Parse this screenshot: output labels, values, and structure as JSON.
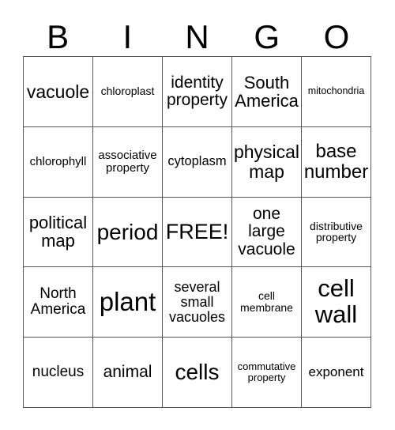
{
  "card": {
    "title": "BINGO",
    "header_letters": [
      "B",
      "I",
      "N",
      "G",
      "O"
    ],
    "columns": 5,
    "rows": 5,
    "free_space": "FREE!",
    "colors": {
      "background": "#ffffff",
      "text": "#000000",
      "grid_line": "#555555"
    },
    "cells": [
      {
        "text": "vacuole",
        "font_size": "23px",
        "row": 1,
        "col": 1
      },
      {
        "text": "chloroplast",
        "font_size": "14px",
        "row": 1,
        "col": 2
      },
      {
        "text": "identity\nproperty",
        "font_size": "21px",
        "row": 1,
        "col": 3
      },
      {
        "text": "South\nAmerica",
        "font_size": "22px",
        "row": 1,
        "col": 4
      },
      {
        "text": "mitochondria",
        "font_size": "12.5px",
        "row": 1,
        "col": 5
      },
      {
        "text": "chlorophyll",
        "font_size": "15px",
        "row": 2,
        "col": 1
      },
      {
        "text": "associative\nproperty",
        "font_size": "15px",
        "row": 2,
        "col": 2
      },
      {
        "text": "cytoplasm",
        "font_size": "16.5px",
        "row": 2,
        "col": 3
      },
      {
        "text": "physical\nmap",
        "font_size": "23px",
        "row": 2,
        "col": 4
      },
      {
        "text": "base\nnumber",
        "font_size": "24px",
        "row": 2,
        "col": 5
      },
      {
        "text": "political\nmap",
        "font_size": "22px",
        "row": 3,
        "col": 1
      },
      {
        "text": "period",
        "font_size": "28px",
        "row": 3,
        "col": 2
      },
      {
        "text": "FREE!",
        "font_size": "27px",
        "row": 3,
        "col": 3
      },
      {
        "text": "one\nlarge\nvacuole",
        "font_size": "21px",
        "row": 3,
        "col": 4
      },
      {
        "text": "distributive\nproperty",
        "font_size": "14px",
        "row": 3,
        "col": 5
      },
      {
        "text": "North\nAmerica",
        "font_size": "19px",
        "row": 4,
        "col": 1
      },
      {
        "text": "plant",
        "font_size": "33px",
        "row": 4,
        "col": 2
      },
      {
        "text": "several\nsmall\nvacuoles",
        "font_size": "18px",
        "row": 4,
        "col": 3
      },
      {
        "text": "cell\nmembrane",
        "font_size": "14px",
        "row": 4,
        "col": 4
      },
      {
        "text": "cell\nwall",
        "font_size": "31px",
        "row": 4,
        "col": 5
      },
      {
        "text": "nucleus",
        "font_size": "19px",
        "row": 5,
        "col": 1
      },
      {
        "text": "animal",
        "font_size": "21px",
        "row": 5,
        "col": 2
      },
      {
        "text": "cells",
        "font_size": "28px",
        "row": 5,
        "col": 3
      },
      {
        "text": "commutative\nproperty",
        "font_size": "13px",
        "row": 5,
        "col": 4
      },
      {
        "text": "exponent",
        "font_size": "17px",
        "row": 5,
        "col": 5
      }
    ]
  }
}
